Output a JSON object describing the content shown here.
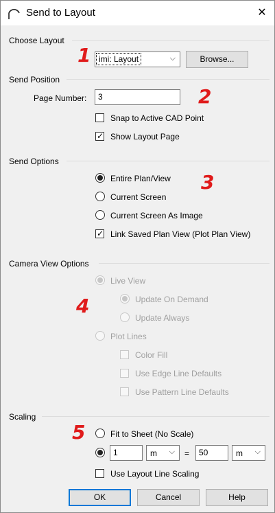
{
  "window": {
    "title": "Send to Layout",
    "close_glyph": "✕",
    "app_icon": "arc-icon"
  },
  "choose_layout": {
    "group_label": "Choose Layout",
    "annotation": "1",
    "layout_select_value": "imi: Layout",
    "browse_label": "Browse..."
  },
  "send_position": {
    "group_label": "Send Position",
    "annotation": "2",
    "page_number_label": "Page Number:",
    "page_number_value": "3",
    "snap_label": "Snap to Active CAD Point",
    "snap_checked": false,
    "show_layout_label": "Show Layout Page",
    "show_layout_checked": true
  },
  "send_options": {
    "group_label": "Send Options",
    "annotation": "3",
    "entire_plan_label": "Entire Plan/View",
    "current_screen_label": "Current Screen",
    "current_screen_image_label": "Current Screen As Image",
    "selected": "entire_plan",
    "link_saved_label": "Link Saved Plan View (Plot Plan View)",
    "link_saved_checked": true
  },
  "camera_view": {
    "group_label": "Camera View Options",
    "annotation": "4",
    "live_view_label": "Live View",
    "update_on_demand_label": "Update On Demand",
    "update_always_label": "Update Always",
    "plot_lines_label": "Plot Lines",
    "color_fill_label": "Color Fill",
    "edge_line_label": "Use Edge Line Defaults",
    "pattern_line_label": "Use Pattern Line Defaults"
  },
  "scaling": {
    "group_label": "Scaling",
    "annotation": "5",
    "fit_to_sheet_label": "Fit to Sheet (No Scale)",
    "selected": "custom_scale",
    "scale_left_value": "1",
    "scale_left_unit": "m",
    "equals": "=",
    "scale_right_value": "50",
    "scale_right_unit": "m",
    "layout_line_scaling_label": "Use Layout Line Scaling",
    "layout_line_scaling_checked": false
  },
  "buttons": {
    "ok": "OK",
    "cancel": "Cancel",
    "help": "Help"
  },
  "colors": {
    "annotation": "#e01b1b",
    "default_button_border": "#0078d7",
    "dialog_bg": "#f0f0f0"
  },
  "glyphs": {
    "check": "✓",
    "chevron": "⌵"
  }
}
